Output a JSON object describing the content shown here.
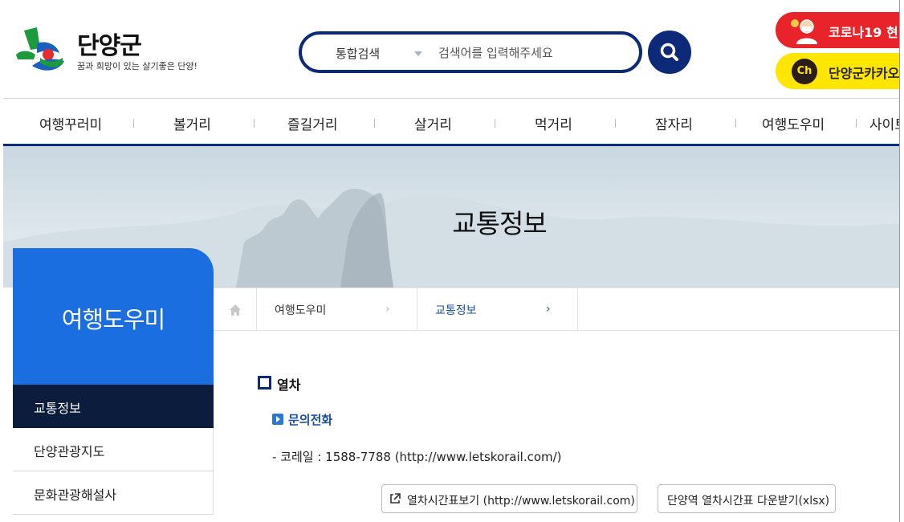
{
  "header": {
    "logo_title": "단양군",
    "logo_slogan": "꿈과 희망이 있는 살기좋은 단양!",
    "search": {
      "category": "통합검색",
      "placeholder": "검색어를 입력해주세요"
    },
    "corona_label": "코로나19 현",
    "kakao_icon_text": "Ch",
    "kakao_label": "단양군카카오"
  },
  "gnb": {
    "items": [
      "여행꾸러미",
      "볼거리",
      "즐길거리",
      "살거리",
      "먹거리",
      "잠자리",
      "여행도우미",
      "사이트"
    ]
  },
  "visual": {
    "title": "교통정보"
  },
  "lnb": {
    "title": "여행도우미",
    "items": [
      "교통정보",
      "단양관광지도",
      "문화관광해설사"
    ]
  },
  "breadcrumb": {
    "items": [
      "여행도우미",
      "교통정보"
    ]
  },
  "content": {
    "section_title": "열차",
    "sub_title": "문의전화",
    "info_line": "- 코레일 : 1588-7788 (http://www.letskorail.com/)",
    "buttons": {
      "timetable": "열차시간표보기 (http://www.letskorail.com)",
      "download": "단양역 열차시간표 다운받기(xlsx)"
    }
  },
  "colors": {
    "brand_navy": "#0c2a78",
    "lnb_blue": "#1a6ee0",
    "lnb_active": "#0c1c3c",
    "corona_red": "#e8232a",
    "kakao_yellow": "#ffe600"
  },
  "icons": [
    "logo-mark",
    "search-icon",
    "corona-icon",
    "kakao-channel-icon",
    "home-icon",
    "chevron-right-icon",
    "square-bullet-icon",
    "play-bullet-icon",
    "external-link-icon"
  ]
}
